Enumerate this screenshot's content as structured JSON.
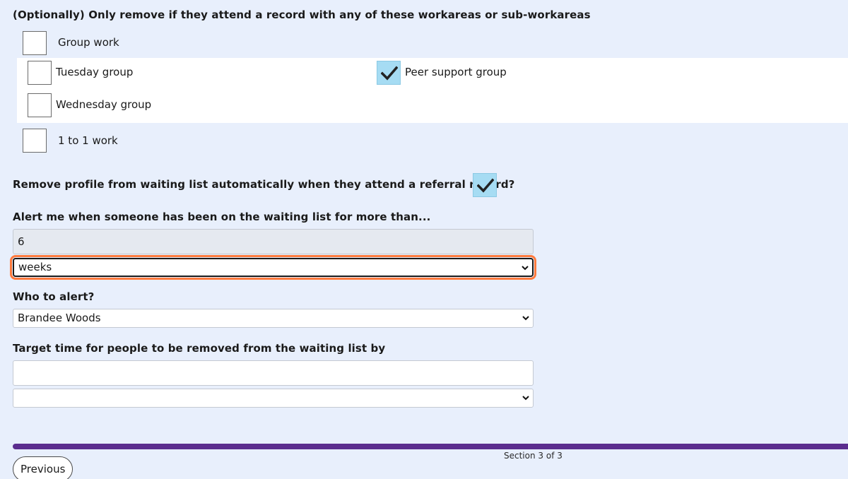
{
  "workarea_section": {
    "heading": "(Optionally) Only remove if they attend a record with any of these workareas or sub-workareas",
    "items": [
      {
        "label": "Group work",
        "checked": false
      },
      {
        "label": "Tuesday group",
        "checked": false
      },
      {
        "label": "Peer support group",
        "checked": true
      },
      {
        "label": "Wednesday group",
        "checked": false
      },
      {
        "label": "1 to 1 work",
        "checked": false
      }
    ]
  },
  "auto_remove": {
    "label": "Remove profile from waiting list automatically when they attend a referral record?",
    "checked": true
  },
  "alert": {
    "label": "Alert me when someone has been on the waiting list for more than...",
    "amount_value": "6",
    "unit_selected": "weeks"
  },
  "who_to_alert": {
    "label": "Who to alert?",
    "selected": "Brandee Woods"
  },
  "target_time": {
    "label": "Target time for people to be removed from the waiting list by",
    "amount_value": "",
    "unit_selected": ""
  },
  "footer": {
    "section_text": "Section 3 of 3",
    "previous_label": "Previous",
    "progress_color": "#5b2d8e"
  },
  "colors": {
    "page_bg": "#e8effc",
    "checked_bg": "#a6dcf3",
    "focus_ring": "#ff7a3d"
  },
  "icons": {
    "check": "checkmark-icon",
    "select_arrow": "chevron-down-icon"
  }
}
